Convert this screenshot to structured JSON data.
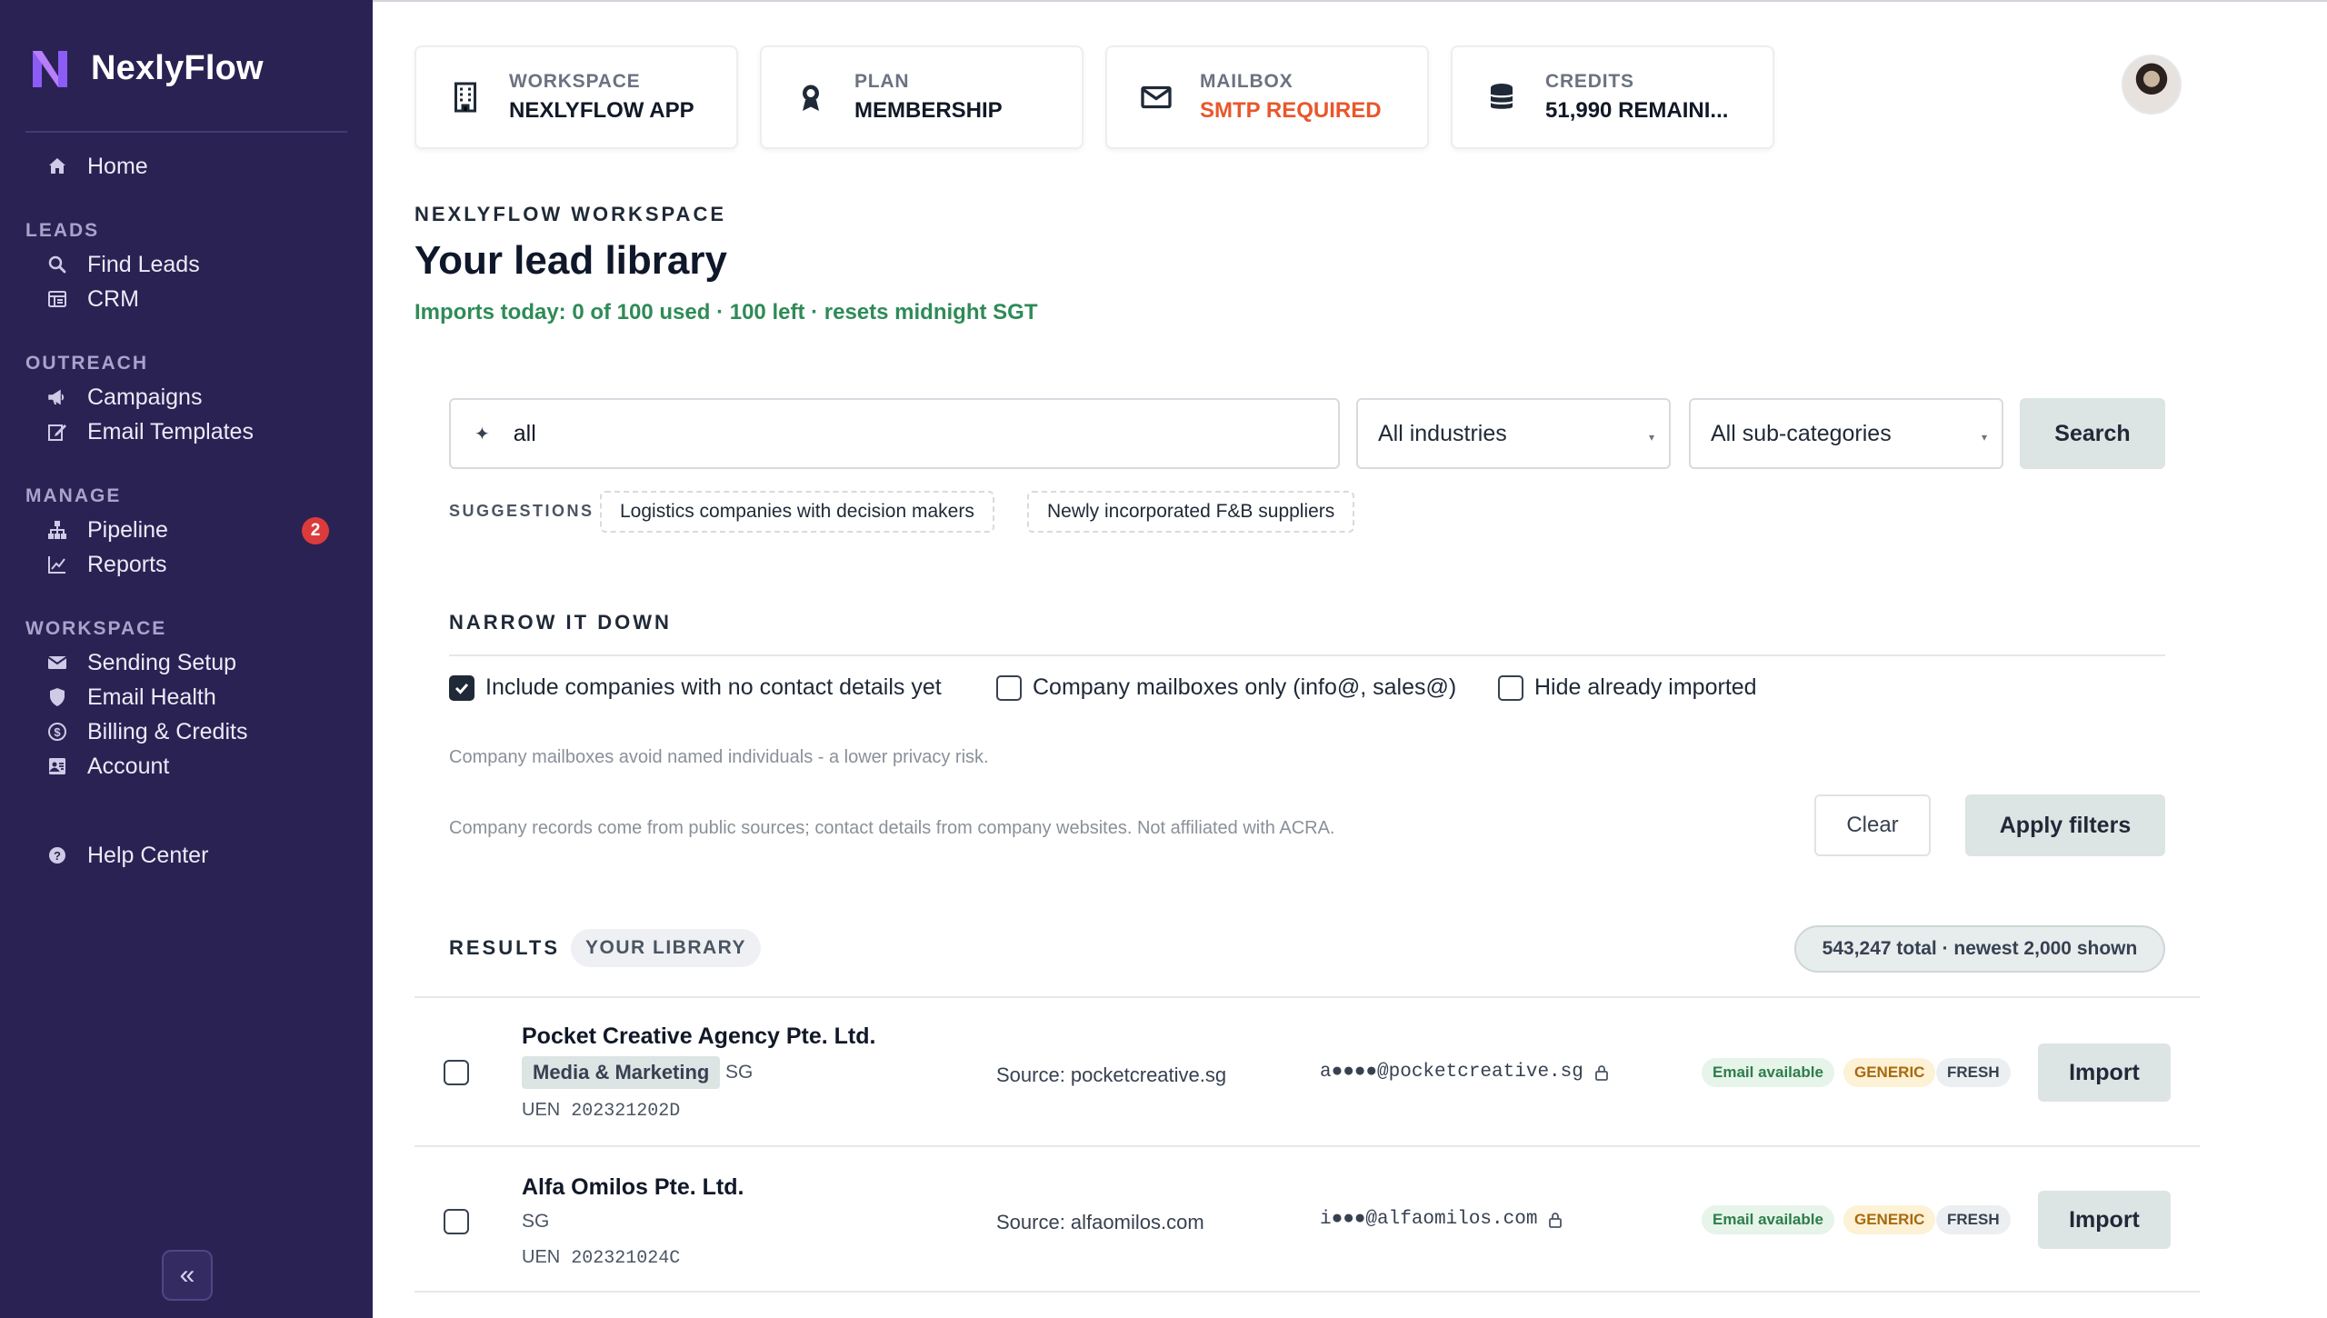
{
  "app": {
    "name": "NexlyFlow"
  },
  "colors": {
    "sidebar": "#2a2253",
    "accent_green": "#2e8b57",
    "warning": "#e8572b",
    "badge": "#dc3b3b"
  },
  "sidebar": {
    "home": "Home",
    "sections": {
      "leads": "LEADS",
      "outreach": "OUTREACH",
      "manage": "MANAGE",
      "workspace": "WORKSPACE"
    },
    "items": {
      "find_leads": "Find Leads",
      "crm": "CRM",
      "campaigns": "Campaigns",
      "email_templates": "Email Templates",
      "pipeline": "Pipeline",
      "pipeline_badge": "2",
      "reports": "Reports",
      "sending_setup": "Sending Setup",
      "email_health": "Email Health",
      "billing": "Billing & Credits",
      "account": "Account",
      "help": "Help Center"
    },
    "collapse": "«"
  },
  "topcards": [
    {
      "label": "WORKSPACE",
      "value": "NEXLYFLOW APP",
      "icon": "building-icon"
    },
    {
      "label": "PLAN",
      "value": "MEMBERSHIP",
      "icon": "award-icon"
    },
    {
      "label": "MAILBOX",
      "value": "SMTP REQUIRED",
      "icon": "envelope-icon"
    },
    {
      "label": "CREDITS",
      "value": "51,990 REMAINI...",
      "icon": "database-icon"
    }
  ],
  "header": {
    "eyebrow": "NEXLYFLOW WORKSPACE",
    "title": "Your lead library",
    "imports": "Imports today: 0 of 100 used · 100 left · resets midnight SGT"
  },
  "search": {
    "spark": "✦",
    "value": "all",
    "industry": "All industries",
    "subcategory": "All sub-categories",
    "button": "Search"
  },
  "suggestions": {
    "label": "SUGGESTIONS",
    "items": [
      "Logistics companies with decision makers",
      "Newly incorporated F&B suppliers"
    ]
  },
  "filters": {
    "heading": "NARROW IT DOWN",
    "options": [
      {
        "label": "Include companies with no contact details yet",
        "checked": true
      },
      {
        "label": "Company mailboxes only (info@, sales@)",
        "checked": false
      },
      {
        "label": "Hide already imported",
        "checked": false
      }
    ],
    "note1": "Company mailboxes avoid named individuals - a lower privacy risk.",
    "note2": "Company records come from public sources; contact details from company websites. Not affiliated with ACRA.",
    "clear": "Clear",
    "apply": "Apply filters"
  },
  "results": {
    "heading": "RESULTS",
    "tab": "YOUR LIBRARY",
    "total": "543,247 total · newest 2,000 shown",
    "rows": [
      {
        "name": "Pocket Creative Agency Pte. Ltd.",
        "tag": "Media & Marketing",
        "country": "SG",
        "uen_label": "UEN",
        "uen": "202321202D",
        "source": "Source: pocketcreative.sg",
        "email": "a●●●●@pocketcreative.sg",
        "pill1": "Email available",
        "pill2": "GENERIC",
        "pill3": "FRESH",
        "action": "Import"
      },
      {
        "name": "Alfa Omilos Pte. Ltd.",
        "tag": "",
        "country": "SG",
        "uen_label": "UEN",
        "uen": "202321024C",
        "source": "Source: alfaomilos.com",
        "email": "i●●●@alfaomilos.com",
        "pill1": "Email available",
        "pill2": "GENERIC",
        "pill3": "FRESH",
        "action": "Import"
      }
    ]
  }
}
